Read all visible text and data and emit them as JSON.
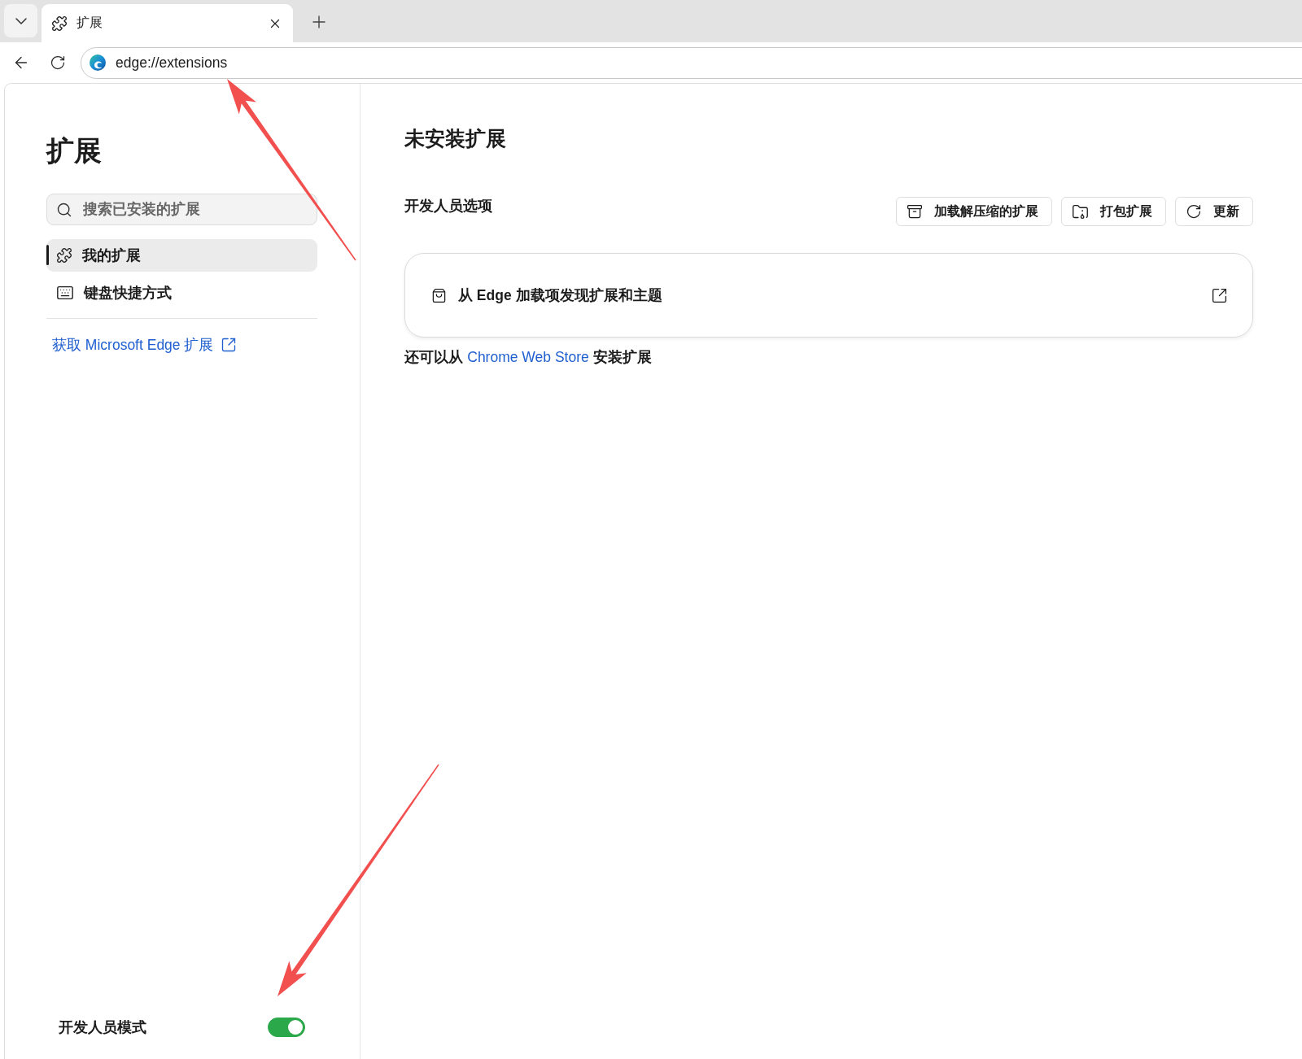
{
  "browser": {
    "tabs": [
      {
        "title": "扩展",
        "selected": true
      }
    ],
    "address": "edge://extensions"
  },
  "sidebar": {
    "title": "扩展",
    "search": {
      "placeholder": "搜索已安装的扩展"
    },
    "nav": [
      {
        "kind": "extensions",
        "label": "我的扩展",
        "selected": true
      },
      {
        "kind": "shortcuts",
        "label": "键盘快捷方式",
        "selected": false
      }
    ],
    "get_extensions_link": "获取 Microsoft Edge 扩展",
    "developer_mode": {
      "label": "开发人员模式",
      "on": true
    }
  },
  "main": {
    "title": "未安装扩展",
    "developer_options": {
      "label": "开发人员选项",
      "buttons": [
        {
          "kind": "load_unpacked",
          "label": "加载解压缩的扩展"
        },
        {
          "kind": "pack",
          "label": "打包扩展"
        },
        {
          "kind": "update",
          "label": "更新"
        }
      ]
    },
    "discover_card": {
      "text": "从 Edge 加载项发现扩展和主题"
    },
    "store_note": {
      "before": "还可以从",
      "link": "Chrome Web Store",
      "after": "安装扩展"
    }
  }
}
